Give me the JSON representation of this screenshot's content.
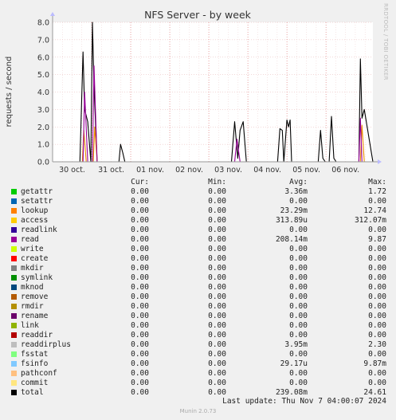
{
  "chart_data": {
    "type": "line",
    "title": "NFS Server - by week",
    "ylabel": "requests / second",
    "ylim": [
      0,
      8
    ],
    "yticks": [
      "0.0",
      "1.0",
      "2.0",
      "3.0",
      "4.0",
      "5.0",
      "6.0",
      "7.0",
      "8.0"
    ],
    "xlim": [
      0,
      8.2
    ],
    "categories": [
      "30 oct.",
      "31 oct.",
      "01 nov.",
      "02 nov.",
      "03 nov.",
      "04 nov.",
      "05 nov.",
      "06 nov."
    ],
    "grid": true,
    "series": [
      {
        "name": "total",
        "color": "#000000",
        "x": [
          0,
          0.6,
          0.7,
          0.78,
          0.82,
          0.9,
          0.98,
          1.02,
          1.06,
          1.14,
          1.2,
          1.7,
          1.74,
          1.8,
          1.85,
          4.5,
          4.58,
          4.66,
          4.74,
          4.8,
          4.88,
          4.96,
          5.7,
          5.76,
          5.82,
          5.88,
          5.92,
          6.0,
          6.04,
          6.08,
          6.12,
          6.16,
          6.2,
          6.8,
          6.86,
          6.92,
          6.98,
          7.08,
          7.14,
          7.2,
          7.26,
          7.8,
          7.84,
          7.88,
          7.92,
          7.98,
          8.2
        ],
        "values": [
          0,
          0,
          0,
          6.3,
          3.0,
          2.3,
          0,
          8.0,
          4.3,
          0,
          0,
          0,
          1.0,
          0.5,
          0,
          0,
          0,
          2.3,
          0.2,
          1.8,
          2.3,
          0,
          0,
          0,
          1.9,
          1.8,
          0,
          2.4,
          2.0,
          2.4,
          0,
          0,
          0,
          0,
          1.8,
          0.2,
          0,
          0,
          2.6,
          0.2,
          0,
          0,
          0,
          5.9,
          2.5,
          3.0,
          0
        ]
      },
      {
        "name": "lookup",
        "color": "#ea8f00",
        "x": [
          0,
          0.76,
          0.8,
          0.86,
          1.04,
          1.08,
          1.14,
          7.88,
          7.92,
          7.98,
          8.2
        ],
        "values": [
          0,
          0,
          1.8,
          0,
          0,
          2.0,
          0,
          0,
          2.1,
          0,
          0
        ]
      },
      {
        "name": "read",
        "color": "#990099",
        "x": [
          0,
          0.78,
          0.82,
          0.9,
          1.02,
          1.06,
          1.14,
          4.66,
          4.72,
          4.8,
          7.84,
          7.88,
          7.92,
          8.2
        ],
        "values": [
          0,
          0,
          4.0,
          0,
          0,
          5.5,
          0,
          0,
          1.3,
          0,
          0,
          2.5,
          0,
          0
        ]
      }
    ]
  },
  "side_text": "RRDTOOL / TOBI OETIKER",
  "legend": {
    "header": {
      "cur": "Cur:",
      "min": "Min:",
      "avg": "Avg:",
      "max": "Max:"
    },
    "rows": [
      {
        "name": "getattr",
        "color": "#00cc00",
        "cur": "0.00",
        "min": "0.00",
        "avg": "3.36m",
        "max": "1.72"
      },
      {
        "name": "setattr",
        "color": "#0066b3",
        "cur": "0.00",
        "min": "0.00",
        "avg": "0.00",
        "max": "0.00"
      },
      {
        "name": "lookup",
        "color": "#ff8000",
        "cur": "0.00",
        "min": "0.00",
        "avg": "23.29m",
        "max": "12.74"
      },
      {
        "name": "access",
        "color": "#ffcc00",
        "cur": "0.00",
        "min": "0.00",
        "avg": "313.89u",
        "max": "312.07m"
      },
      {
        "name": "readlink",
        "color": "#330099",
        "cur": "0.00",
        "min": "0.00",
        "avg": "0.00",
        "max": "0.00"
      },
      {
        "name": "read",
        "color": "#990099",
        "cur": "0.00",
        "min": "0.00",
        "avg": "208.14m",
        "max": "9.87"
      },
      {
        "name": "write",
        "color": "#ccff00",
        "cur": "0.00",
        "min": "0.00",
        "avg": "0.00",
        "max": "0.00"
      },
      {
        "name": "create",
        "color": "#ff0000",
        "cur": "0.00",
        "min": "0.00",
        "avg": "0.00",
        "max": "0.00"
      },
      {
        "name": "mkdir",
        "color": "#808080",
        "cur": "0.00",
        "min": "0.00",
        "avg": "0.00",
        "max": "0.00"
      },
      {
        "name": "symlink",
        "color": "#008f00",
        "cur": "0.00",
        "min": "0.00",
        "avg": "0.00",
        "max": "0.00"
      },
      {
        "name": "mknod",
        "color": "#00487d",
        "cur": "0.00",
        "min": "0.00",
        "avg": "0.00",
        "max": "0.00"
      },
      {
        "name": "remove",
        "color": "#b35a00",
        "cur": "0.00",
        "min": "0.00",
        "avg": "0.00",
        "max": "0.00"
      },
      {
        "name": "rmdir",
        "color": "#b38f00",
        "cur": "0.00",
        "min": "0.00",
        "avg": "0.00",
        "max": "0.00"
      },
      {
        "name": "rename",
        "color": "#6b006b",
        "cur": "0.00",
        "min": "0.00",
        "avg": "0.00",
        "max": "0.00"
      },
      {
        "name": "link",
        "color": "#8fb300",
        "cur": "0.00",
        "min": "0.00",
        "avg": "0.00",
        "max": "0.00"
      },
      {
        "name": "readdir",
        "color": "#b30000",
        "cur": "0.00",
        "min": "0.00",
        "avg": "0.00",
        "max": "0.00"
      },
      {
        "name": "readdirplus",
        "color": "#bebebe",
        "cur": "0.00",
        "min": "0.00",
        "avg": "3.95m",
        "max": "2.30"
      },
      {
        "name": "fsstat",
        "color": "#80ff80",
        "cur": "0.00",
        "min": "0.00",
        "avg": "0.00",
        "max": "0.00"
      },
      {
        "name": "fsinfo",
        "color": "#80c9ff",
        "cur": "0.00",
        "min": "0.00",
        "avg": "29.17u",
        "max": "9.87m"
      },
      {
        "name": "pathconf",
        "color": "#ffc080",
        "cur": "0.00",
        "min": "0.00",
        "avg": "0.00",
        "max": "0.00"
      },
      {
        "name": "commit",
        "color": "#ffe680",
        "cur": "0.00",
        "min": "0.00",
        "avg": "0.00",
        "max": "0.00"
      },
      {
        "name": "total",
        "color": "#000000",
        "cur": "0.00",
        "min": "0.00",
        "avg": "239.08m",
        "max": "24.61"
      }
    ]
  },
  "last_update": "Last update: Thu Nov  7 04:00:07 2024",
  "footer": "Munin 2.0.73"
}
